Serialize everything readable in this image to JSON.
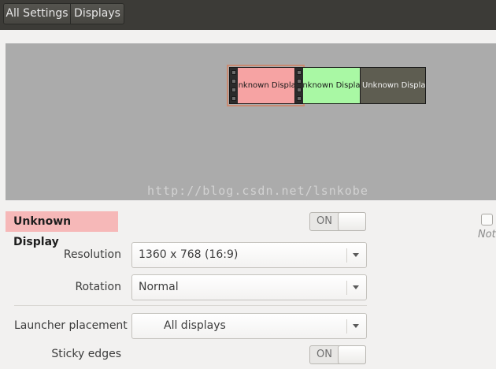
{
  "header": {
    "breadcrumbs": [
      "All Settings",
      "Displays"
    ]
  },
  "arrangement": {
    "monitors": [
      {
        "label": "Unknown Display",
        "color": "#f6a3a3",
        "selected": true
      },
      {
        "label": "Unknown Display",
        "color": "#a9f8a4",
        "selected": false
      },
      {
        "label": "Unknown Display",
        "color": "#5e5d51",
        "selected": false
      }
    ],
    "watermark": "http://blog.csdn.net/lsnkobe"
  },
  "display": {
    "name": "Unknown Display",
    "name_badge_color": "#f6b8b8",
    "switch_label": "ON",
    "switch_state": true
  },
  "side": {
    "note": "Not"
  },
  "form": {
    "resolution": {
      "label": "Resolution",
      "value": "1360 x 768 (16:9)"
    },
    "rotation": {
      "label": "Rotation",
      "value": "Normal"
    },
    "launcher": {
      "label": "Launcher placement",
      "value": "All displays"
    },
    "sticky": {
      "label": "Sticky edges",
      "switch_label": "ON",
      "switch_state": true
    }
  },
  "colors": {
    "header_bg": "#3c3b37",
    "canvas_bg": "#ababab",
    "window_bg": "#f2f1f0"
  }
}
